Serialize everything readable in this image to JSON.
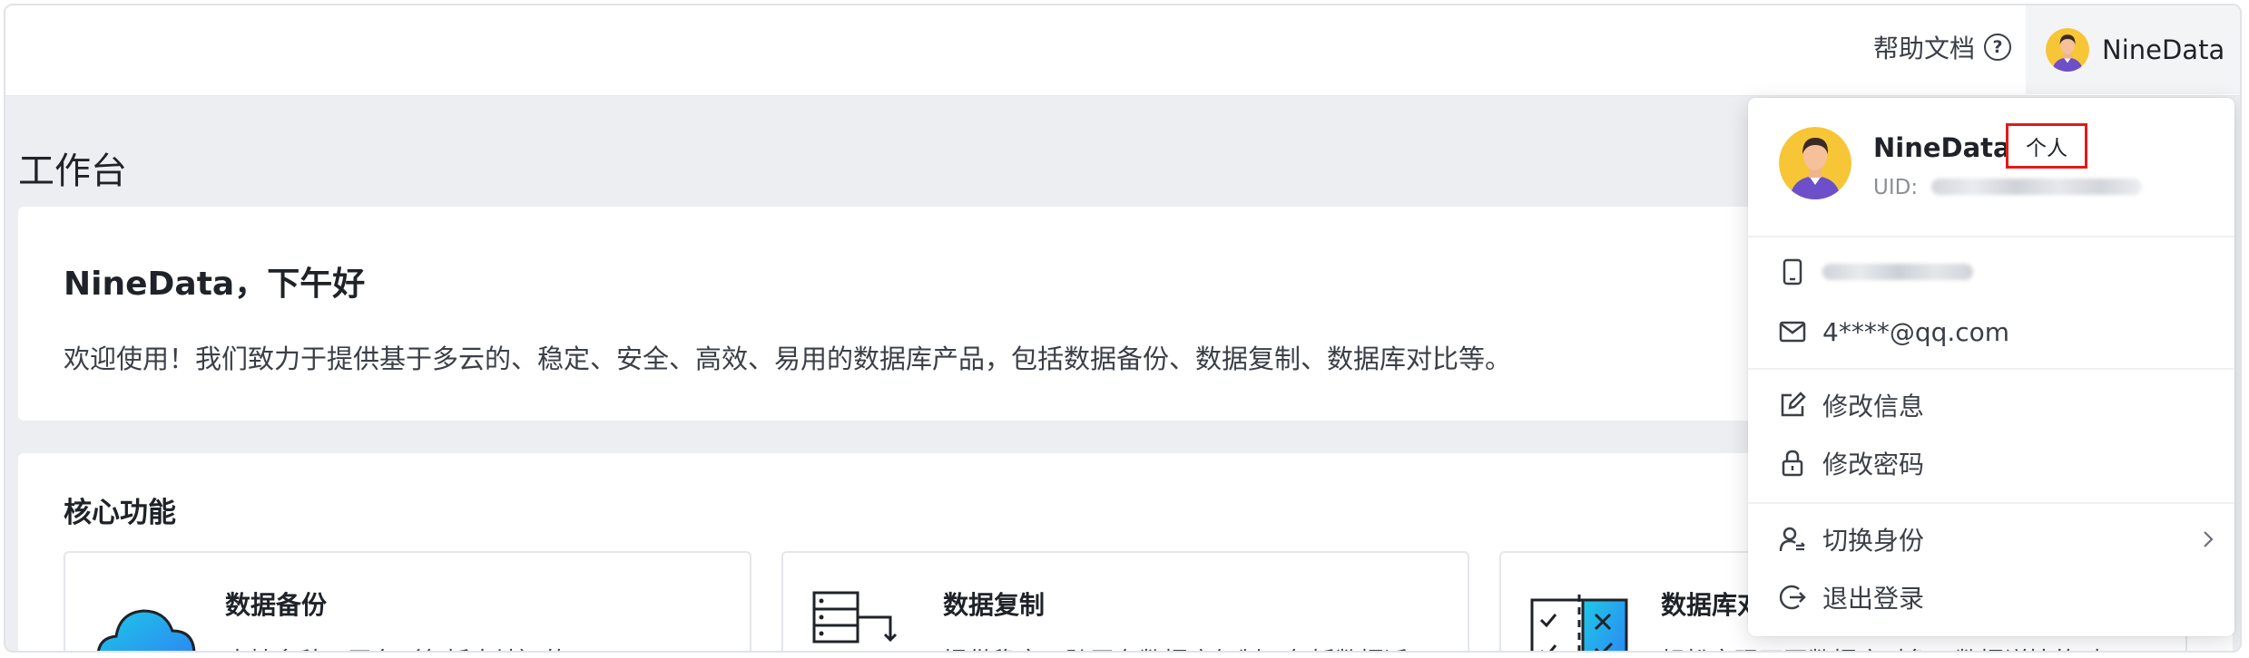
{
  "header": {
    "help_label": "帮助文档",
    "help_icon": "question-circle-icon",
    "user_name": "NineData"
  },
  "page": {
    "title": "工作台"
  },
  "welcome": {
    "title": "NineData，下午好",
    "text": "欢迎使用！我们致力于提供基于多云的、稳定、安全、高效、易用的数据库产品，包括数据备份、数据复制、数据库对比等。"
  },
  "core": {
    "title": "核心功能",
    "features": [
      {
        "title": "数据备份",
        "desc": "支持多种云平台（包括本地）的 MySQL",
        "icon": "cloud-upload-icon"
      },
      {
        "title": "数据复制",
        "desc": "提供稳定、跨平台数据库复制，包括数据迁",
        "icon": "server-sync-icon"
      },
      {
        "title": "数据库对比",
        "desc": "轻松实现不同数据库对象、数据详情的对",
        "icon": "compare-checklist-icon"
      }
    ]
  },
  "profile_menu": {
    "name": "NineData",
    "badge": "个人",
    "uid_label": "UID:",
    "email": "4****@qq.com",
    "items": [
      {
        "label": "修改信息",
        "icon": "edit-icon"
      },
      {
        "label": "修改密码",
        "icon": "lock-icon"
      },
      {
        "label": "切换身份",
        "icon": "switch-user-icon"
      },
      {
        "label": "退出登录",
        "icon": "logout-icon"
      }
    ]
  },
  "colors": {
    "badge_border": "#e21b1b",
    "page_bg": "#eceef2",
    "icon_gradient_start": "#1ec8e6",
    "icon_gradient_end": "#2f7cf6"
  }
}
